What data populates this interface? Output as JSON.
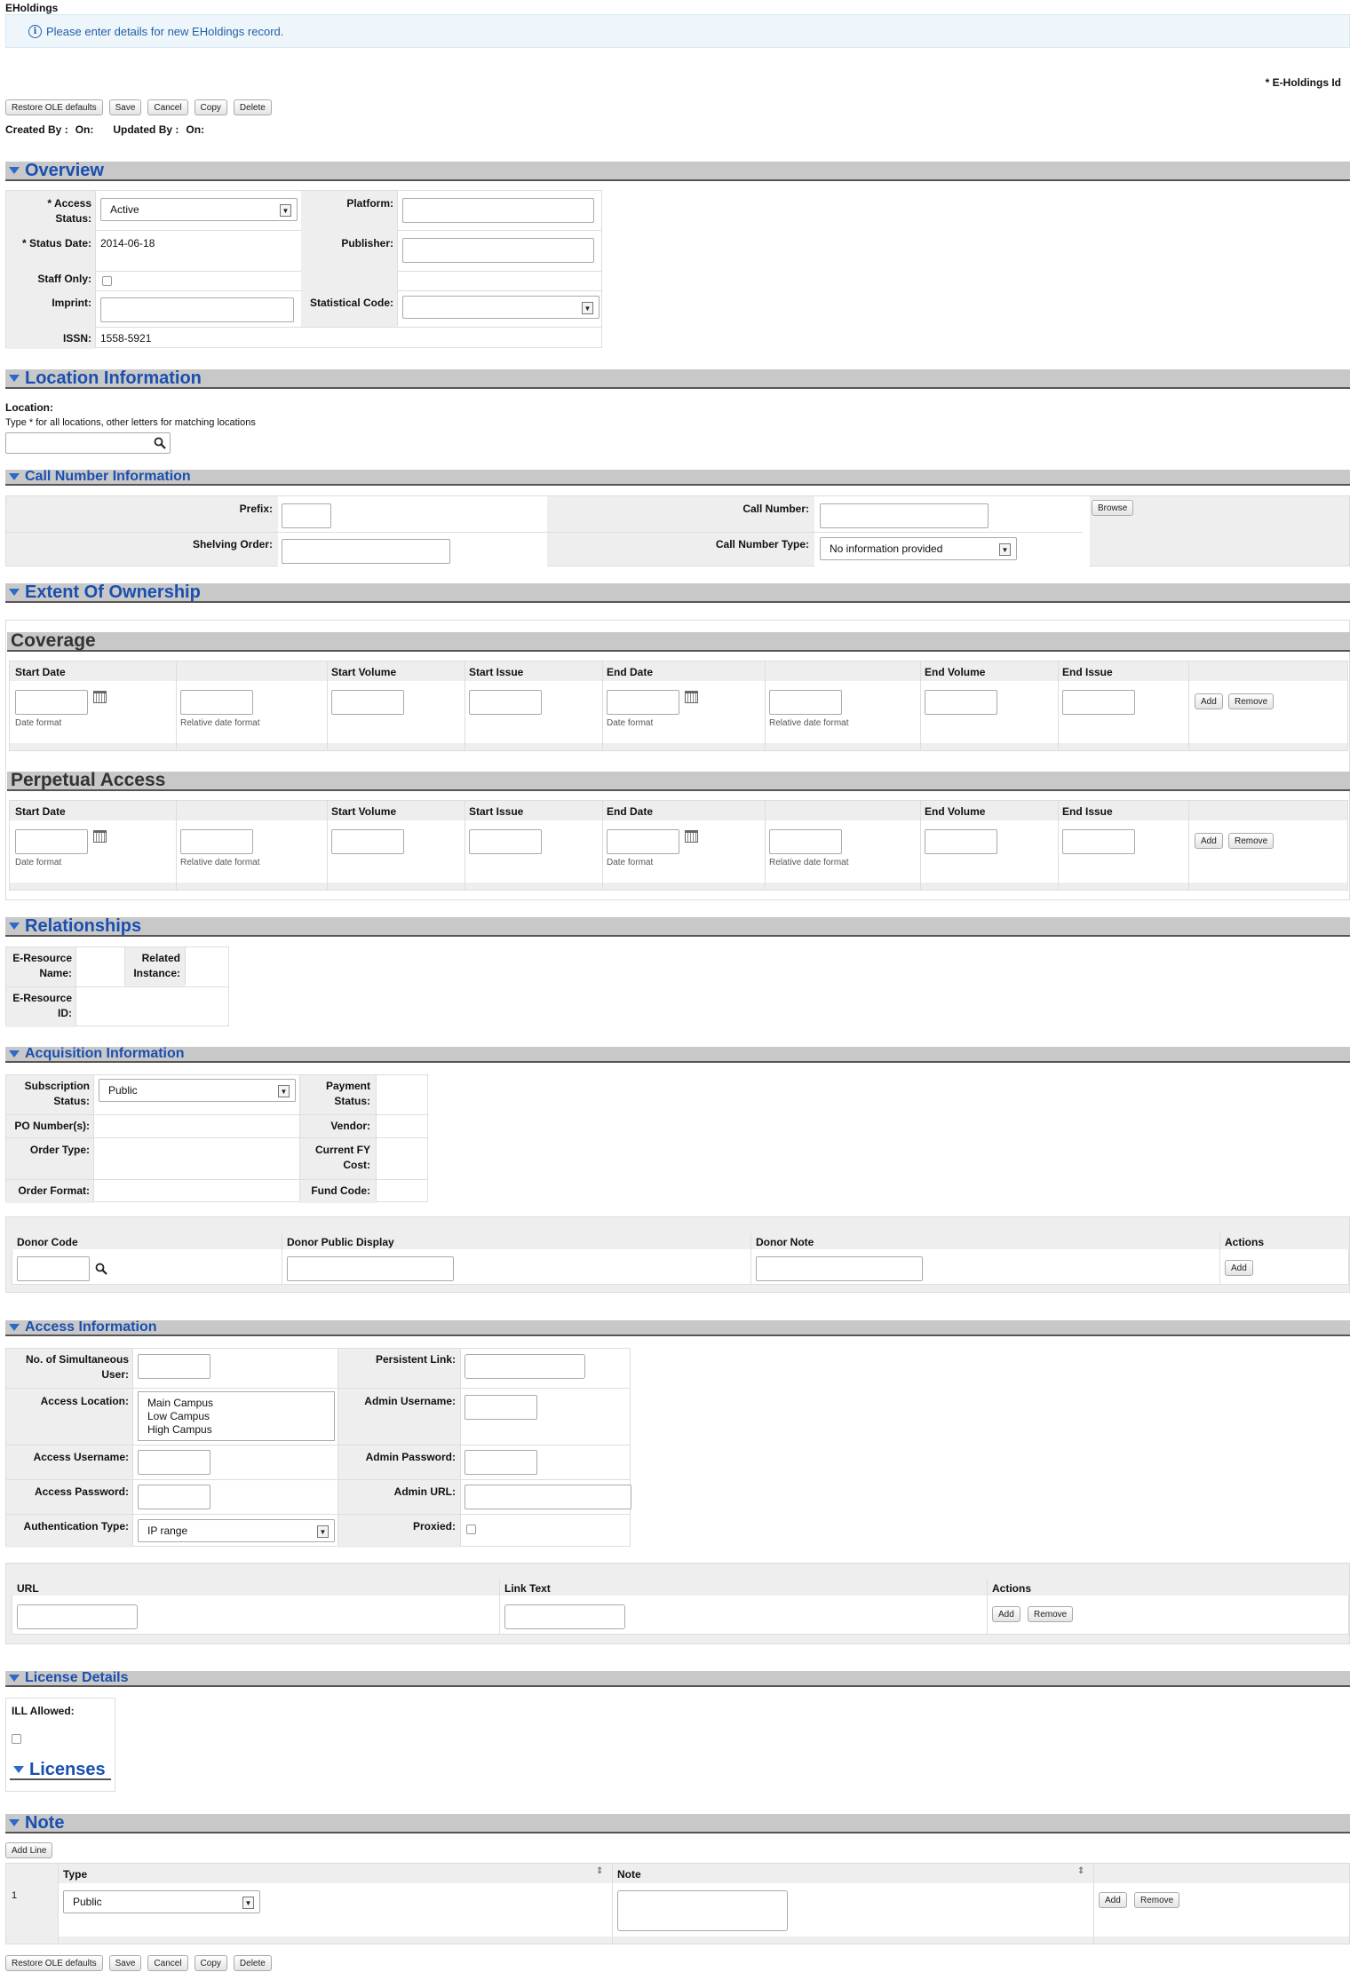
{
  "header": {
    "title": "EHoldings",
    "info": "Please enter details for new EHoldings record.",
    "eholdings_id_label": "* E-Holdings Id"
  },
  "buttons": {
    "restore": "Restore OLE defaults",
    "save": "Save",
    "cancel": "Cancel",
    "copy": "Copy",
    "delete": "Delete"
  },
  "meta": {
    "created_by": "Created By :",
    "created_on": "On:",
    "updated_by": "Updated By :",
    "updated_on": "On:"
  },
  "overview": {
    "title": "Overview",
    "access_status_label": "* Access Status:",
    "access_status_value": "Active",
    "platform_label": "Platform:",
    "status_date_label": "* Status Date:",
    "status_date_value": "2014-06-18",
    "publisher_label": "Publisher:",
    "staff_only_label": "Staff Only:",
    "imprint_label": "Imprint:",
    "statistical_code_label": "Statistical Code:",
    "issn_label": "ISSN:",
    "issn_value": "1558-5921"
  },
  "location": {
    "title": "Location Information",
    "label": "Location:",
    "hint": "Type * for all locations, other letters for matching locations"
  },
  "callnumber": {
    "title": "Call Number Information",
    "prefix_label": "Prefix:",
    "call_number_label": "Call Number:",
    "browse": "Browse",
    "shelving_label": "Shelving Order:",
    "type_label": "Call Number Type:",
    "type_value": "No information provided"
  },
  "extent": {
    "title": "Extent Of Ownership",
    "coverage": "Coverage",
    "perpetual": "Perpetual Access",
    "cols": [
      "Start Date",
      "",
      "Start Volume",
      "Start Issue",
      "End Date",
      "",
      "End Volume",
      "End Issue"
    ],
    "date_format": "Date format",
    "relative_format": "Relative date format",
    "add": "Add",
    "remove": "Remove"
  },
  "relationships": {
    "title": "Relationships",
    "eresource_name": "E-Resource Name:",
    "related_instance": "Related Instance:",
    "eresource_id": "E-Resource ID:"
  },
  "acquisition": {
    "title": "Acquisition Information",
    "subscription_label": "Subscription Status:",
    "subscription_value": "Public",
    "payment_label": "Payment Status:",
    "po_label": "PO Number(s):",
    "vendor_label": "Vendor:",
    "order_type_label": "Order Type:",
    "fy_cost_label": "Current FY Cost:",
    "order_format_label": "Order Format:",
    "fund_code_label": "Fund Code:",
    "donor_code": "Donor Code",
    "donor_public": "Donor Public Display",
    "donor_note": "Donor Note",
    "actions": "Actions",
    "add": "Add"
  },
  "access": {
    "title": "Access Information",
    "simul_label": "No. of Simultaneous User:",
    "persistent_label": "Persistent Link:",
    "location_label": "Access Location:",
    "locations": [
      "Main Campus",
      "Low Campus",
      "High Campus"
    ],
    "admin_user_label": "Admin Username:",
    "access_user_label": "Access Username:",
    "admin_pass_label": "Admin Password:",
    "access_pass_label": "Access Password:",
    "admin_url_label": "Admin URL:",
    "auth_label": "Authentication Type:",
    "auth_value": "IP range",
    "proxied_label": "Proxied:",
    "url": "URL",
    "link_text": "Link Text",
    "actions": "Actions",
    "add": "Add",
    "remove": "Remove"
  },
  "license": {
    "title": "License Details",
    "ill_label": "ILL Allowed:",
    "licenses": "Licenses"
  },
  "note": {
    "title": "Note",
    "add_line": "Add Line",
    "type_col": "Type",
    "note_col": "Note",
    "row_num": "1",
    "type_value": "Public",
    "add": "Add",
    "remove": "Remove"
  }
}
